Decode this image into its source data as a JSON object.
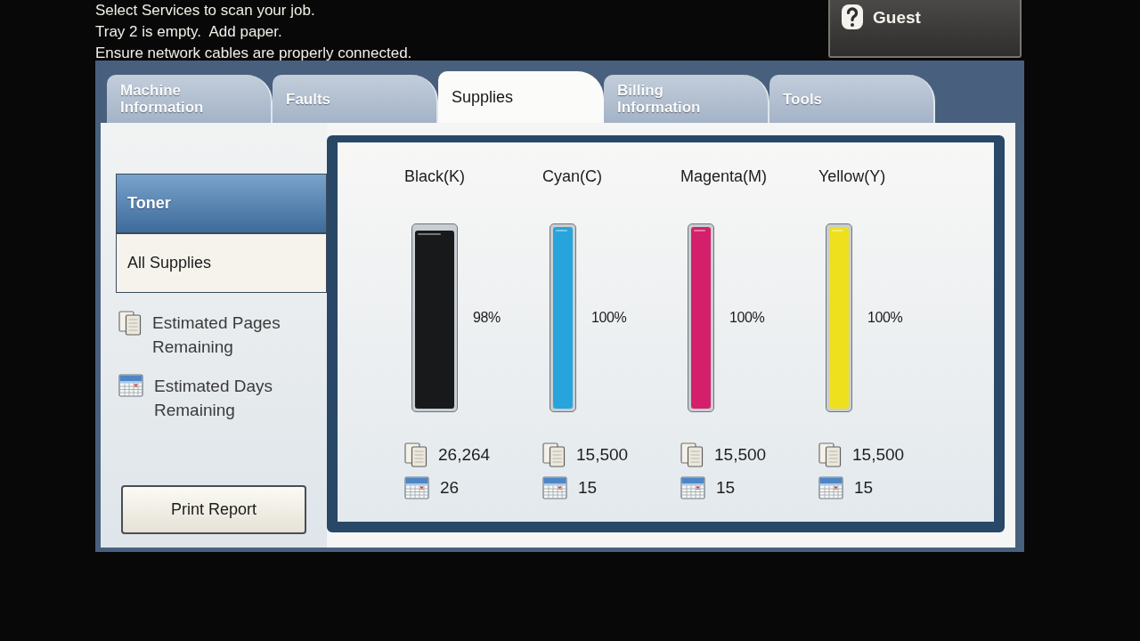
{
  "messages": [
    "Select Services to scan your job.",
    "Tray 2 is empty.  Add paper.",
    "Ensure network cables are properly connected."
  ],
  "user_button": {
    "label": "Guest"
  },
  "tabs": [
    {
      "label": "Machine Information",
      "selected": false
    },
    {
      "label": "Faults",
      "selected": false
    },
    {
      "label": "Supplies",
      "selected": true
    },
    {
      "label": "Billing Information",
      "selected": false
    },
    {
      "label": "Tools",
      "selected": false
    }
  ],
  "sidebar": {
    "items": [
      {
        "label": "Toner",
        "selected": true
      },
      {
        "label": "All Supplies",
        "selected": false
      }
    ],
    "legend": [
      {
        "kind": "pages",
        "label": "Estimated Pages Remaining"
      },
      {
        "kind": "days",
        "label": "Estimated Days Remaining"
      }
    ],
    "print_button": "Print Report"
  },
  "toners": [
    {
      "name": "Black(K)",
      "kind": "large",
      "color": "#18191b",
      "level": 0.98,
      "percent": "98%",
      "counts": [
        {
          "kind": "pages",
          "value": "26,264"
        },
        {
          "kind": "days",
          "value": "26"
        }
      ]
    },
    {
      "name": "Cyan(C)",
      "kind": "standard",
      "color": "#27a4dc",
      "level": 1,
      "percent": "100%",
      "counts": [
        {
          "kind": "pages",
          "value": "15,500"
        },
        {
          "kind": "days",
          "value": "15"
        }
      ]
    },
    {
      "name": "Magenta(M)",
      "kind": "standard",
      "color": "#d4206b",
      "level": 1,
      "percent": "100%",
      "counts": [
        {
          "kind": "pages",
          "value": "15,500"
        },
        {
          "kind": "days",
          "value": "15"
        }
      ]
    },
    {
      "name": "Yellow(Y)",
      "kind": "standard",
      "color": "#efe01e",
      "level": 1,
      "percent": "100%",
      "counts": [
        {
          "kind": "pages",
          "value": "15,500"
        },
        {
          "kind": "days",
          "value": "15"
        }
      ]
    }
  ]
}
